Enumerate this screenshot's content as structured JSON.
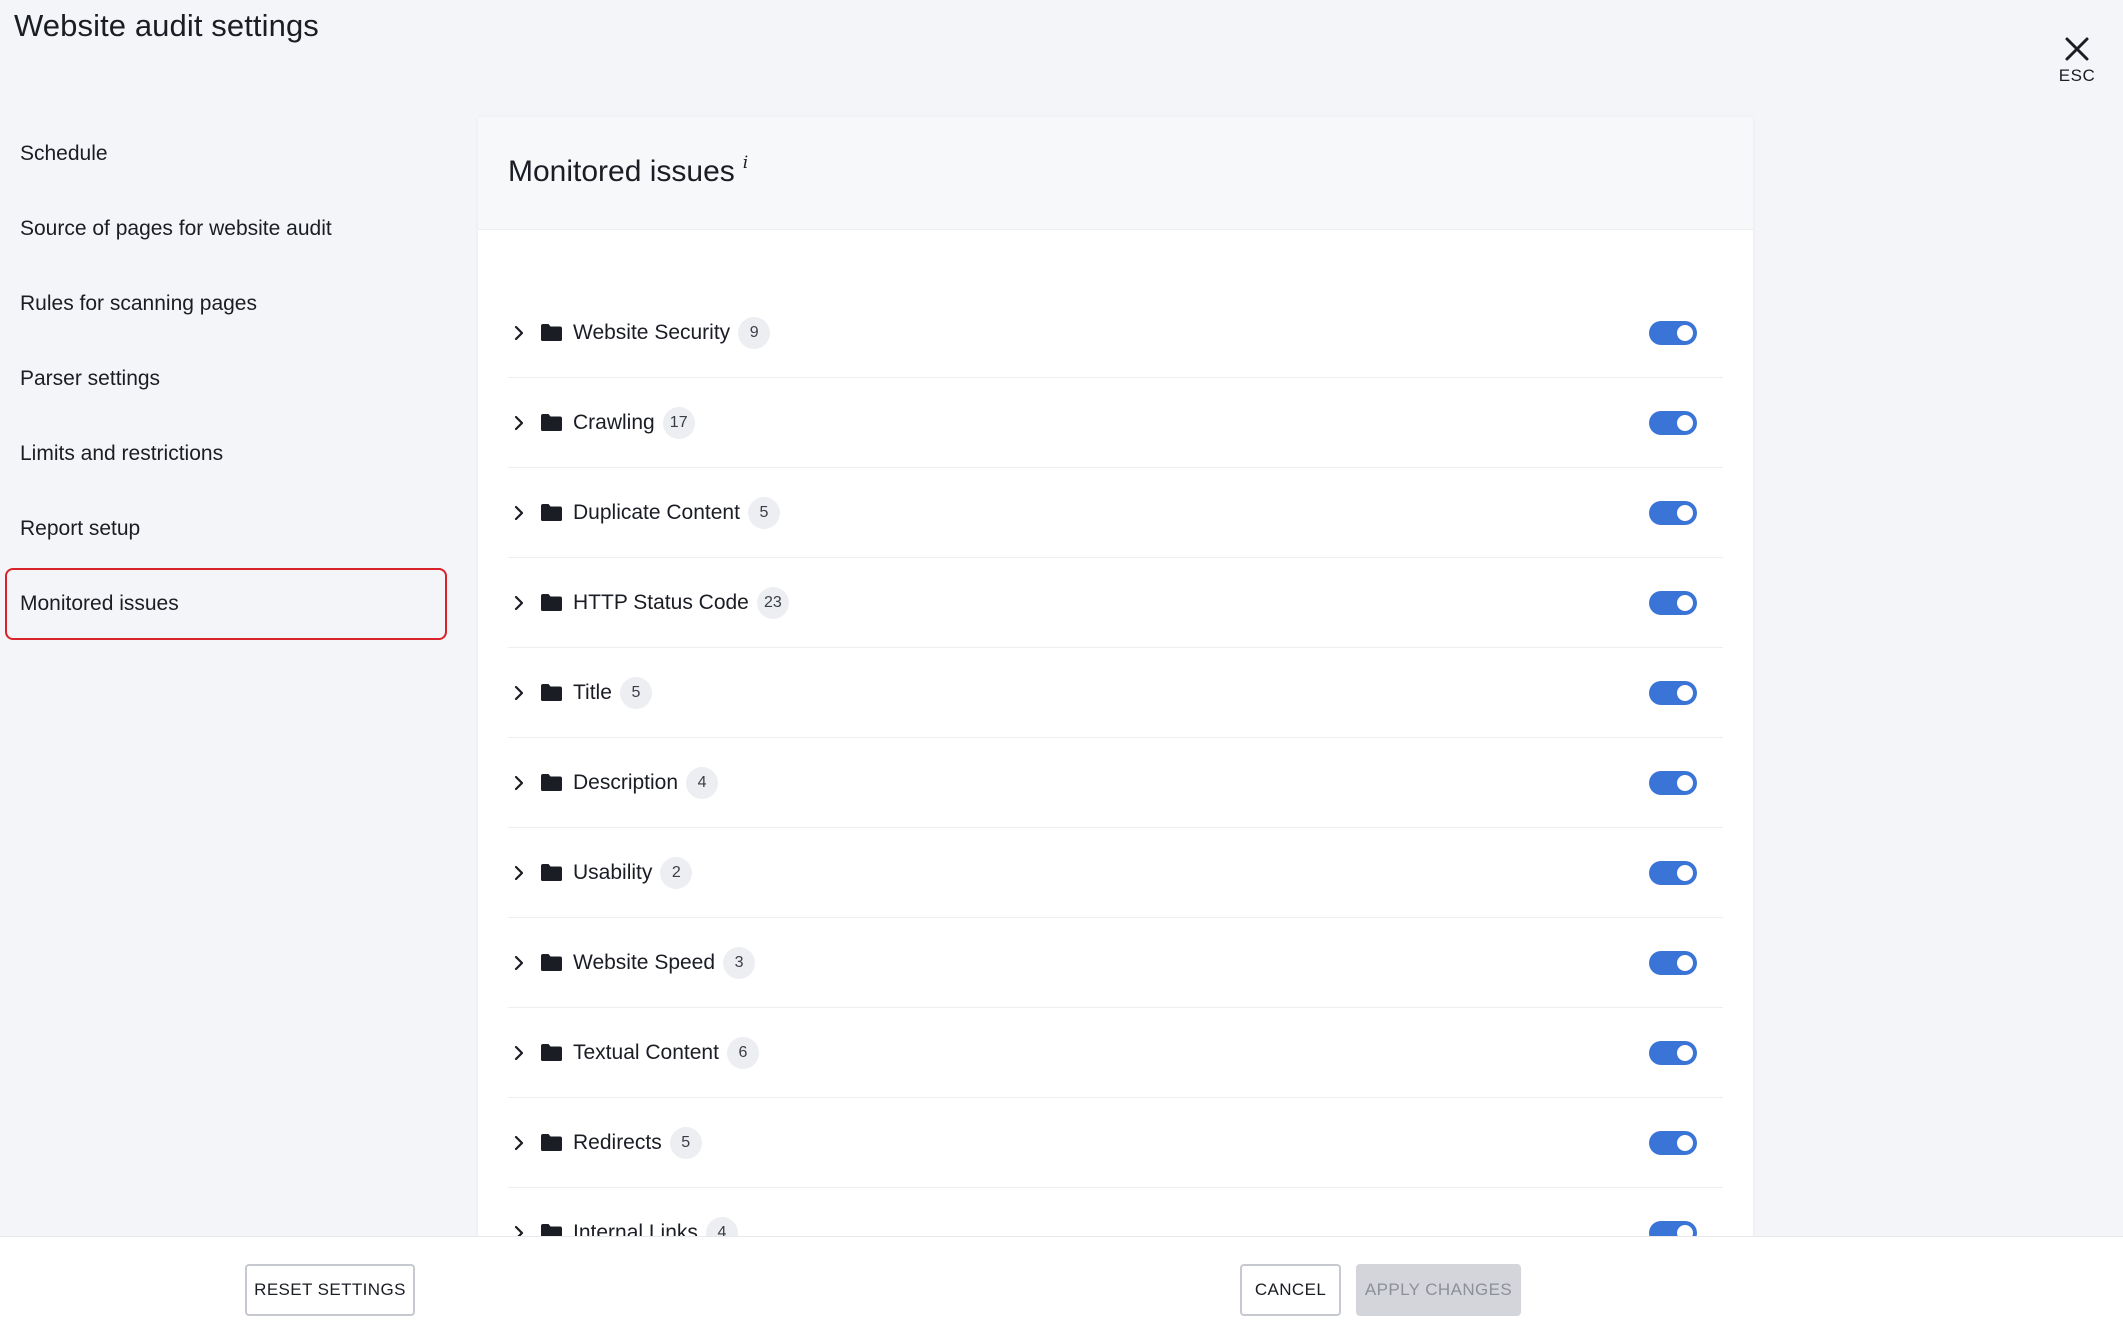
{
  "header": {
    "title": "Website audit settings",
    "close_label": "ESC"
  },
  "sidebar": {
    "items": [
      {
        "label": "Schedule",
        "active": false
      },
      {
        "label": "Source of pages for website audit",
        "active": false
      },
      {
        "label": "Rules for scanning pages",
        "active": false
      },
      {
        "label": "Parser settings",
        "active": false
      },
      {
        "label": "Limits and restrictions",
        "active": false
      },
      {
        "label": "Report setup",
        "active": false
      },
      {
        "label": "Monitored issues",
        "active": true
      }
    ]
  },
  "panel": {
    "title": "Monitored issues",
    "info_glyph": "i",
    "issues": [
      {
        "name": "Website Security",
        "count": "9",
        "enabled": true
      },
      {
        "name": "Crawling",
        "count": "17",
        "enabled": true
      },
      {
        "name": "Duplicate Content",
        "count": "5",
        "enabled": true
      },
      {
        "name": "HTTP Status Code",
        "count": "23",
        "enabled": true
      },
      {
        "name": "Title",
        "count": "5",
        "enabled": true
      },
      {
        "name": "Description",
        "count": "4",
        "enabled": true
      },
      {
        "name": "Usability",
        "count": "2",
        "enabled": true
      },
      {
        "name": "Website Speed",
        "count": "3",
        "enabled": true
      },
      {
        "name": "Textual Content",
        "count": "6",
        "enabled": true
      },
      {
        "name": "Redirects",
        "count": "5",
        "enabled": true
      },
      {
        "name": "Internal Links",
        "count": "4",
        "enabled": true
      }
    ]
  },
  "footer": {
    "reset_label": "RESET SETTINGS",
    "cancel_label": "CANCEL",
    "apply_label": "APPLY CHANGES",
    "apply_enabled": false
  },
  "colors": {
    "toggle_on": "#3a74d6",
    "active_border": "#d8232a"
  },
  "icons": {
    "close": "close-icon",
    "chevron": "chevron-right-icon",
    "folder": "folder-icon",
    "info": "info-icon"
  }
}
